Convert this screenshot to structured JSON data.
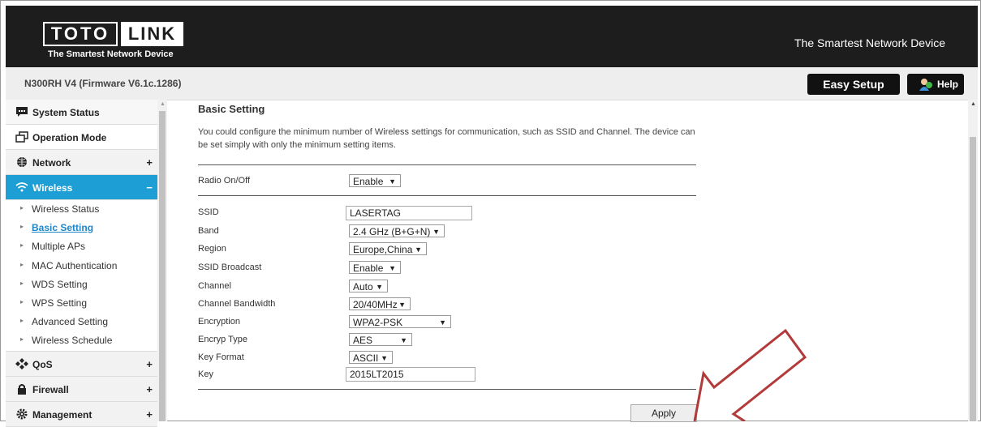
{
  "header": {
    "logo_left": "TOTO",
    "logo_right": "LINK",
    "logo_sub": "The Smartest Network Device",
    "tagline": "The Smartest Network Device"
  },
  "topbar": {
    "model": "N300RH V4 (Firmware V6.1c.1286)",
    "easy_setup": "Easy Setup",
    "help": "Help"
  },
  "sidebar": {
    "system_status": "System Status",
    "operation_mode": "Operation Mode",
    "network": "Network",
    "wireless": "Wireless",
    "wireless_items": [
      "Wireless Status",
      "Basic Setting",
      "Multiple APs",
      "MAC Authentication",
      "WDS Setting",
      "WPS Setting",
      "Advanced Setting",
      "Wireless Schedule"
    ],
    "qos": "QoS",
    "firewall": "Firewall",
    "management": "Management",
    "plus": "+",
    "minus": "−"
  },
  "main": {
    "title": "Basic Setting",
    "description": "You could configure the minimum number of Wireless settings for communication, such as SSID and Channel. The device can be set simply with only the minimum setting items.",
    "radio_label": "Radio On/Off",
    "radio_value": "Enable",
    "fields": {
      "ssid_label": "SSID",
      "ssid_value": "LASERTAG",
      "band_label": "Band",
      "band_value": "2.4 GHz (B+G+N)",
      "region_label": "Region",
      "region_value": "Europe,China",
      "broadcast_label": "SSID Broadcast",
      "broadcast_value": "Enable",
      "channel_label": "Channel",
      "channel_value": "Auto",
      "bandwidth_label": "Channel Bandwidth",
      "bandwidth_value": "20/40MHz",
      "encryption_label": "Encryption",
      "encryption_value": "WPA2-PSK",
      "encryp_type_label": "Encryp Type",
      "encryp_type_value": "AES",
      "key_format_label": "Key Format",
      "key_format_value": "ASCII",
      "key_label": "Key",
      "key_value": "2015LT2015"
    },
    "apply": "Apply"
  },
  "colors": {
    "header_bg": "#1d1d1d",
    "active_menu": "#1d9fd6",
    "arrow": "#b23a3a"
  }
}
